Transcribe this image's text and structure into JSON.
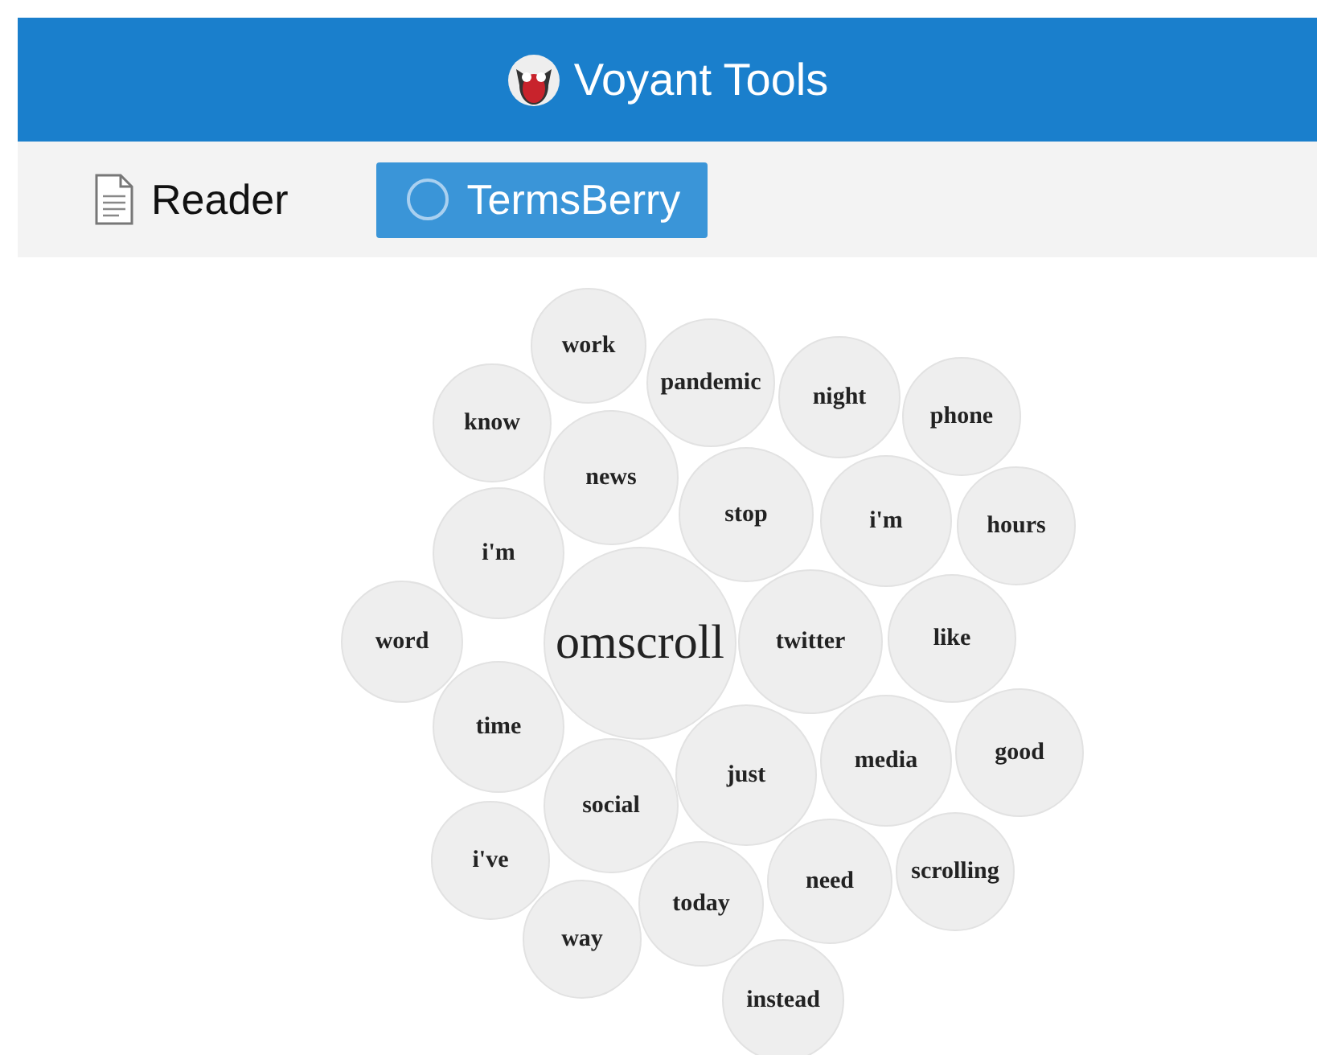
{
  "header": {
    "title": "Voyant Tools"
  },
  "tabs": [
    {
      "label": "Reader",
      "kind": "document",
      "selected": false
    },
    {
      "label": "TermsBerry",
      "kind": "berry",
      "selected": true
    }
  ],
  "terms": [
    "work",
    "pandemic",
    "know",
    "night",
    "phone",
    "news",
    "stop",
    "i'm",
    "hours",
    "i'm",
    "word",
    "omscroll",
    "twitter",
    "like",
    "time",
    "good",
    "media",
    "just",
    "social",
    "i've",
    "need",
    "scrolling",
    "today",
    "way",
    "instead"
  ]
}
